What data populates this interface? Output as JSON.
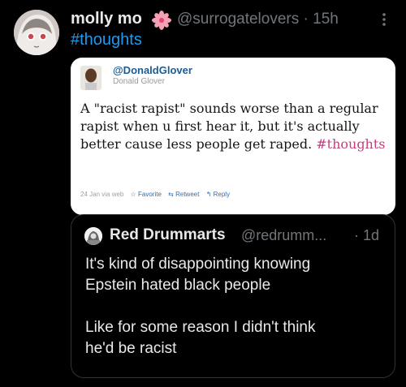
{
  "post": {
    "author_name": "molly mo",
    "author_handle": "@surrogatelovers",
    "timestamp": "15h",
    "separator": "·",
    "hashtag": "#thoughts",
    "colors": {
      "accent": "#1d9bf0",
      "muted": "#71767b",
      "text": "#e7e9ea",
      "background": "#000000"
    },
    "icons": [
      "avatar",
      "flower-emoji-icon",
      "more-options-icon"
    ]
  },
  "embedded_tweet": {
    "username": "@DonaldGlover",
    "realname": "Donald Glover",
    "text_body": "A \"racist rapist\" sounds worse than a regular rapist when u first hear it, but it's actually better cause less people get raped. ",
    "hashtag": "#thoughts",
    "meta": "24 Jan via web",
    "actions": {
      "favorite": "Favorite",
      "retweet": "Retweet",
      "reply": "Reply"
    },
    "icons": [
      "star-icon",
      "retweet-icon",
      "reply-icon"
    ]
  },
  "quote": {
    "name": "Red Drummarts",
    "handle": "@redrumm...",
    "separator": "·",
    "time": "1d",
    "text": "It's kind of disappointing knowing\nEpstein hated black people\n\nLike for some reason I didn't think\nhe'd be racist"
  }
}
